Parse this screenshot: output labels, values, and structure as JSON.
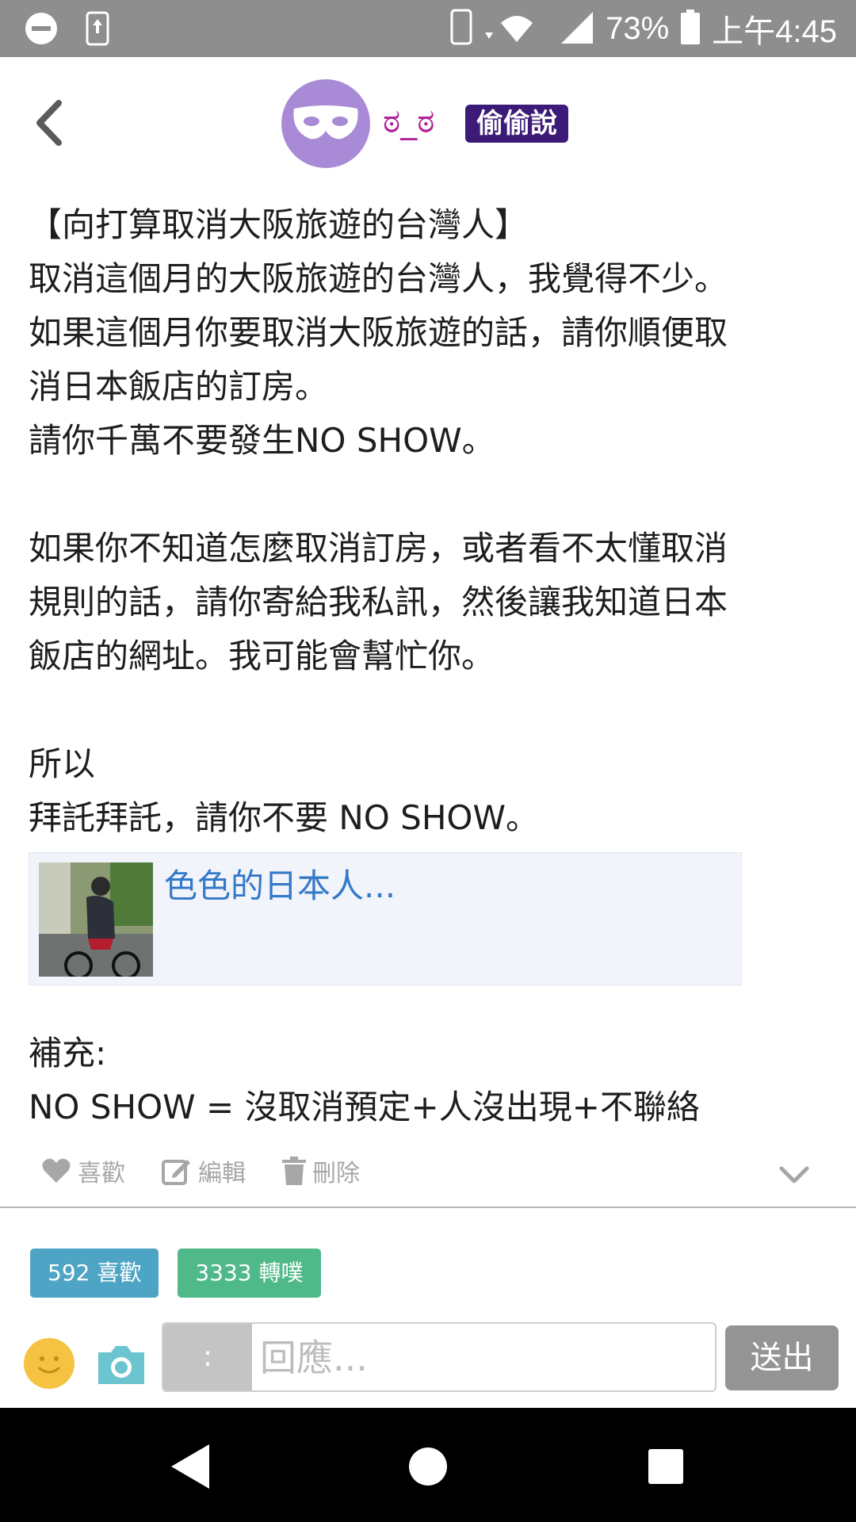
{
  "status_bar": {
    "battery": "73%",
    "time": "上午4:45"
  },
  "header": {
    "username": "ಠ_ಠ",
    "badge": "偷偷說"
  },
  "post": {
    "lines": [
      "【向打算取消大阪旅遊的台灣人】",
      "取消這個月的大阪旅遊的台灣人，我覺得不少。",
      "如果這個月你要取消大阪旅遊的話，請你順便取",
      "消日本飯店的訂房。",
      "請你千萬不要發生NO SHOW。",
      "",
      "如果你不知道怎麼取消訂房，或者看不太懂取消",
      "規則的話，請你寄給我私訊，然後讓我知道日本",
      "飯店的網址。我可能會幫忙你。",
      "",
      "所以",
      "拜託拜託，請你不要 NO SHOW。"
    ],
    "link_card_title": "色色的日本人...",
    "tail_lines": [
      "補充:",
      "NO SHOW = 沒取消預定+人沒出現+不聯絡"
    ]
  },
  "actions": {
    "like": "喜歡",
    "edit": "編輯",
    "delete": "刪除"
  },
  "counts": {
    "likes": "592 喜歡",
    "replurks": "3333 轉噗"
  },
  "reply": {
    "qualifier": ":",
    "placeholder": "回應...",
    "send": "送出"
  },
  "colors": {
    "status_bar": "#8e8e8e",
    "username": "#b0249b",
    "badge": "#3b1a78",
    "likes": "#4ea4c4",
    "replurks": "#4fb98a",
    "link": "#3478c8"
  }
}
